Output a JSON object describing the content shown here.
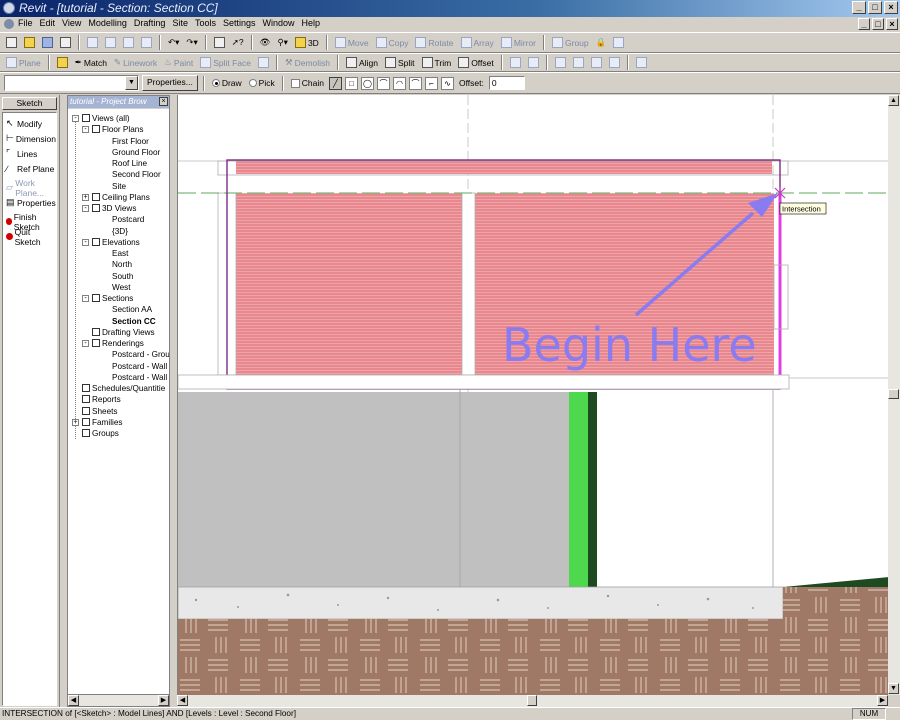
{
  "window": {
    "title": "Revit - [tutorial - Section: Section CC]",
    "controls": [
      "_",
      "□",
      "×"
    ],
    "mdi_controls": [
      "_",
      "□",
      "×"
    ]
  },
  "menu": [
    "File",
    "Edit",
    "View",
    "Modelling",
    "Drafting",
    "Site",
    "Tools",
    "Settings",
    "Window",
    "Help"
  ],
  "toolbar1": {
    "view_3d_label": "3D",
    "move": "Move",
    "copy": "Copy",
    "rotate": "Rotate",
    "array": "Array",
    "mirror": "Mirror",
    "group": "Group"
  },
  "toolbar2": {
    "plane": "Plane",
    "match": "Match",
    "linework": "Linework",
    "paint": "Paint",
    "split_face": "Split Face",
    "demolish": "Demolish",
    "align": "Align",
    "split": "Split",
    "trim": "Trim",
    "offset": "Offset"
  },
  "options_bar": {
    "type_selector_value": "",
    "properties_button": "Properties...",
    "draw_label": "Draw",
    "pick_label": "Pick",
    "draw_selected": true,
    "chain_label": "Chain",
    "chain_checked": false,
    "offset_label": "Offset:",
    "offset_value": "0"
  },
  "design_bar": {
    "tab": "Sketch",
    "items": [
      {
        "label": "Modify",
        "icon": "arrow-cursor-icon",
        "enabled": true
      },
      {
        "label": "Dimension",
        "icon": "dimension-icon",
        "enabled": true
      },
      {
        "label": "Lines",
        "icon": "lines-icon",
        "enabled": true
      },
      {
        "label": "Ref Plane",
        "icon": "ref-plane-icon",
        "enabled": true
      },
      {
        "label": "Work Plane...",
        "icon": "work-plane-icon",
        "enabled": false
      },
      {
        "label": "Properties",
        "icon": "properties-icon",
        "enabled": true
      },
      {
        "label": "Finish Sketch",
        "icon": "finish-sketch-icon",
        "enabled": true
      },
      {
        "label": "Quit Sketch",
        "icon": "quit-sketch-icon",
        "enabled": true
      }
    ]
  },
  "project_browser": {
    "title": "tutorial - Project Brow",
    "tree": [
      {
        "label": "Views (all)",
        "level": 0,
        "expander": "-",
        "icon": "eye-icon"
      },
      {
        "label": "Floor Plans",
        "level": 1,
        "expander": "-",
        "icon": "floor-plan-icon"
      },
      {
        "label": "First Floor",
        "level": 2
      },
      {
        "label": "Ground Floor",
        "level": 2
      },
      {
        "label": "Roof Line",
        "level": 2
      },
      {
        "label": "Second Floor",
        "level": 2
      },
      {
        "label": "Site",
        "level": 2
      },
      {
        "label": "Ceiling Plans",
        "level": 1,
        "expander": "+",
        "icon": "ceiling-plan-icon"
      },
      {
        "label": "3D Views",
        "level": 1,
        "expander": "-",
        "icon": "3d-view-icon"
      },
      {
        "label": "Postcard",
        "level": 2
      },
      {
        "label": "{3D}",
        "level": 2
      },
      {
        "label": "Elevations",
        "level": 1,
        "expander": "-",
        "icon": "elevation-icon"
      },
      {
        "label": "East",
        "level": 2
      },
      {
        "label": "North",
        "level": 2
      },
      {
        "label": "South",
        "level": 2
      },
      {
        "label": "West",
        "level": 2
      },
      {
        "label": "Sections",
        "level": 1,
        "expander": "-",
        "icon": "section-icon"
      },
      {
        "label": "Section AA",
        "level": 2
      },
      {
        "label": "Section CC",
        "level": 2,
        "bold": true
      },
      {
        "label": "Drafting Views",
        "level": 1,
        "icon": "drafting-view-icon"
      },
      {
        "label": "Renderings",
        "level": 1,
        "expander": "-",
        "icon": "rendering-icon"
      },
      {
        "label": "Postcard - Grou",
        "level": 2
      },
      {
        "label": "Postcard - Wall",
        "level": 2
      },
      {
        "label": "Postcard - Wall",
        "level": 2
      },
      {
        "label": "Schedules/Quantitie",
        "level": 0,
        "icon": "schedule-icon"
      },
      {
        "label": "Reports",
        "level": 0,
        "icon": "report-icon"
      },
      {
        "label": "Sheets",
        "level": 0,
        "icon": "sheet-icon"
      },
      {
        "label": "Families",
        "level": 0,
        "expander": "+",
        "icon": "family-icon"
      },
      {
        "label": "Groups",
        "level": 0,
        "icon": "group-icon"
      }
    ]
  },
  "canvas": {
    "annotation": "Begin Here",
    "tooltip": "Intersection",
    "colors": {
      "wall_hatch": "#e8888e",
      "sketch_line": "#d040d0",
      "ground": "#c0c0c0",
      "green_strip": "#4ed84e",
      "dark_green": "#1e4a22",
      "concrete": "#e8e8e8",
      "earth": "#a07866",
      "annotation": "#8a7cf0"
    }
  },
  "status_bar": {
    "text": "INTERSECTION of [<Sketch> : Model Lines] AND [Levels : Level : Second Floor]",
    "num": "NUM"
  }
}
